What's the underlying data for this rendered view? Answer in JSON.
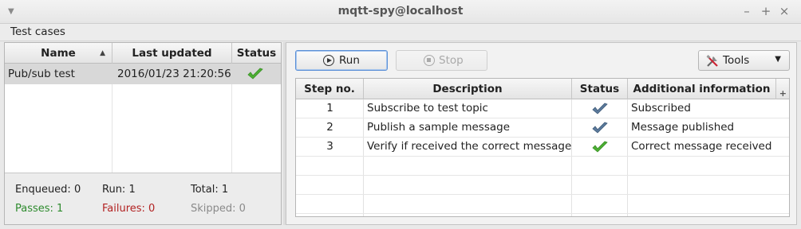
{
  "window": {
    "title": "mqtt-spy@localhost"
  },
  "menubar": {
    "label": "Test cases"
  },
  "cases_table": {
    "columns": [
      "Name",
      "Last updated",
      "Status"
    ],
    "rows": [
      {
        "name": "Pub/sub test",
        "last_updated": "2016/01/23 21:20:56",
        "status": "passed"
      }
    ]
  },
  "summary": {
    "enqueued": "Enqueued: 0",
    "run": "Run: 1",
    "total": "Total: 1",
    "passes": "Passes: 1",
    "failures": "Failures: 0",
    "skipped": "Skipped: 0"
  },
  "toolbar": {
    "run_label": "Run",
    "stop_label": "Stop",
    "tools_label": "Tools"
  },
  "steps_table": {
    "columns": [
      "Step no.",
      "Description",
      "Status",
      "Additional information"
    ],
    "rows": [
      {
        "no": "1",
        "description": "Subscribe to test topic",
        "status": "done",
        "info": "Subscribed"
      },
      {
        "no": "2",
        "description": "Publish a sample message",
        "status": "done",
        "info": "Message published"
      },
      {
        "no": "3",
        "description": "Verify if received the correct message",
        "status": "passed",
        "info": "Correct message received"
      }
    ]
  },
  "colors": {
    "pass_green": "#2e8b2e",
    "fail_red": "#b22222",
    "skip_gray": "#8a8a8a",
    "check_green": "#4caf32",
    "check_blue": "#4f6d8c"
  }
}
